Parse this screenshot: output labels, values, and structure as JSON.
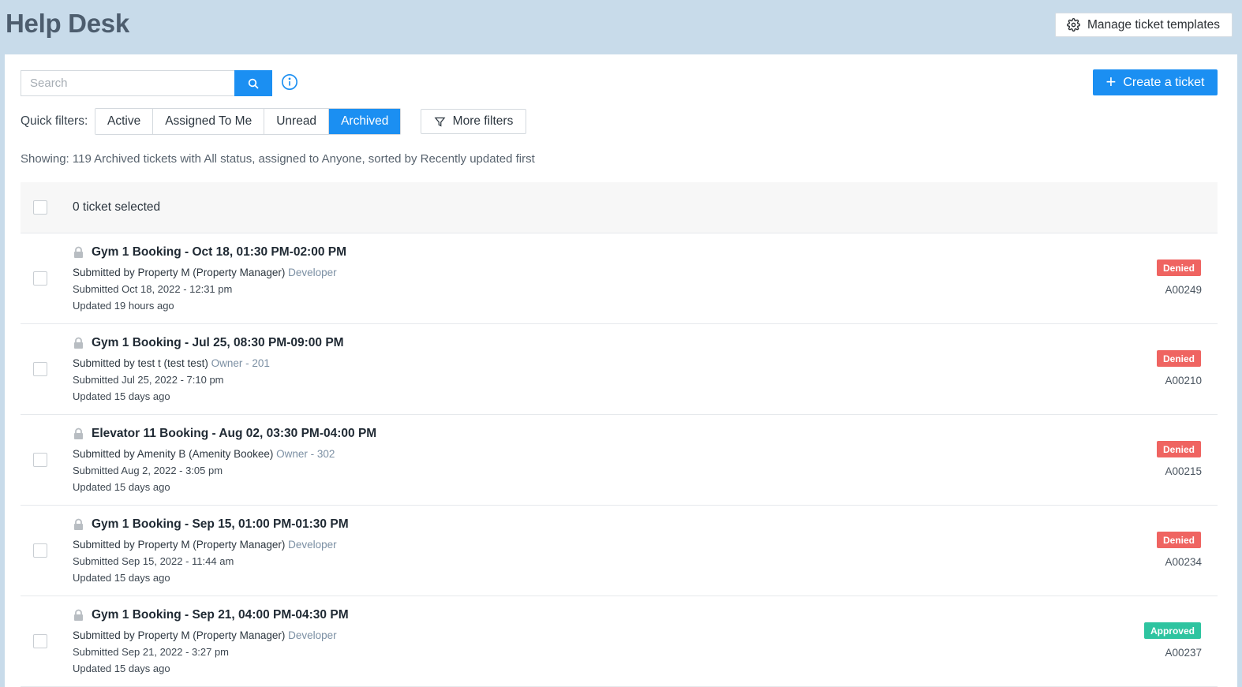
{
  "page": {
    "title": "Help Desk",
    "manage_templates_label": "Manage ticket templates"
  },
  "toolbar": {
    "search_placeholder": "Search",
    "create_label": "Create a ticket"
  },
  "filters": {
    "label": "Quick filters:",
    "options": [
      "Active",
      "Assigned To Me",
      "Unread",
      "Archived"
    ],
    "active": "Archived",
    "more_label": "More filters"
  },
  "summary": "Showing: 119 Archived tickets with All status, assigned to Anyone, sorted by Recently updated first",
  "table": {
    "selected_label": "0 ticket selected",
    "rows": [
      {
        "title": "Gym 1 Booking - Oct 18, 01:30 PM-02:00 PM",
        "submitter": "Submitted by Property M (Property Manager)",
        "role": "Developer",
        "submitted": "Submitted Oct 18, 2022 - 12:31 pm",
        "updated": "Updated 19 hours ago",
        "status": "Denied",
        "id": "A00249"
      },
      {
        "title": "Gym 1 Booking - Jul 25, 08:30 PM-09:00 PM",
        "submitter": "Submitted by test t (test test)",
        "role": "Owner - 201",
        "submitted": "Submitted Jul 25, 2022 - 7:10 pm",
        "updated": "Updated 15 days ago",
        "status": "Denied",
        "id": "A00210"
      },
      {
        "title": "Elevator 11 Booking - Aug 02, 03:30 PM-04:00 PM",
        "submitter": "Submitted by Amenity B (Amenity Bookee)",
        "role": "Owner - 302",
        "submitted": "Submitted Aug 2, 2022 - 3:05 pm",
        "updated": "Updated 15 days ago",
        "status": "Denied",
        "id": "A00215"
      },
      {
        "title": "Gym 1 Booking - Sep 15, 01:00 PM-01:30 PM",
        "submitter": "Submitted by Property M (Property Manager)",
        "role": "Developer",
        "submitted": "Submitted Sep 15, 2022 - 11:44 am",
        "updated": "Updated 15 days ago",
        "status": "Denied",
        "id": "A00234"
      },
      {
        "title": "Gym 1 Booking - Sep 21, 04:00 PM-04:30 PM",
        "submitter": "Submitted by Property M (Property Manager)",
        "role": "Developer",
        "submitted": "Submitted Sep 21, 2022 - 3:27 pm",
        "updated": "Updated 15 days ago",
        "status": "Approved",
        "id": "A00237"
      }
    ]
  },
  "colors": {
    "accent": "#1b8ff2",
    "denied": "#ef6461",
    "approved": "#2ec4a0",
    "header_bg": "#c8dbea"
  },
  "icons": {
    "manage": "gear-icon",
    "search": "search-icon",
    "info": "info-icon",
    "create": "plus-icon",
    "more_filters": "filter-icon",
    "row": "lock-icon"
  }
}
